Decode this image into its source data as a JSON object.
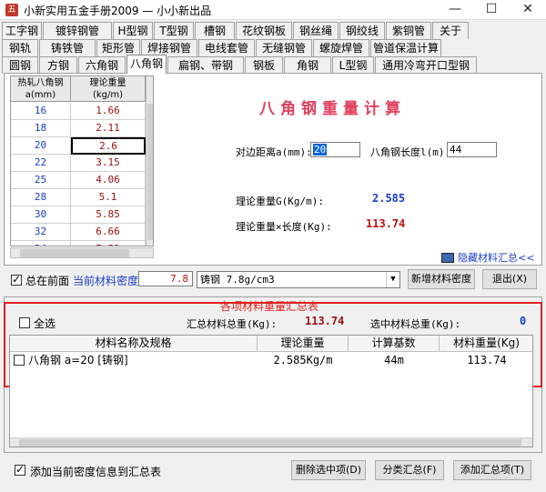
{
  "window": {
    "title": "小新实用五金手册2009 — 小小新出品",
    "app_icon": "app-logo-icon",
    "min_glyph": "—",
    "max_glyph": "☐",
    "close_glyph": "✕"
  },
  "tabs": {
    "row1": [
      "工字钢",
      "镀锌钢管",
      "H型钢",
      "T型钢",
      "槽钢",
      "花纹钢板",
      "钢丝绳",
      "钢绞线",
      "紫铜管",
      "关于"
    ],
    "row2": [
      "钢轨",
      "铸铁管",
      "矩形管",
      "焊接钢管",
      "电线套管",
      "无缝钢管",
      "螺旋焊管",
      "管道保温计算"
    ],
    "row3": [
      "圆钢",
      "方钢",
      "六角钢",
      "八角钢",
      "扁钢、带钢",
      "钢板",
      "角钢",
      "L型钢",
      "通用冷弯开口型钢"
    ],
    "active": "八角钢"
  },
  "table": {
    "header_a": "热轧八角钢\na(mm)",
    "header_w": "理论重量\n(kg/m)",
    "rows": [
      {
        "a": "16",
        "w": "1.66"
      },
      {
        "a": "18",
        "w": "2.11"
      },
      {
        "a": "20",
        "w": "2.6"
      },
      {
        "a": "22",
        "w": "3.15"
      },
      {
        "a": "25",
        "w": "4.06"
      },
      {
        "a": "28",
        "w": "5.1"
      },
      {
        "a": "30",
        "w": "5.85"
      },
      {
        "a": "32",
        "w": "6.66"
      },
      {
        "a": "34",
        "w": "7.51"
      }
    ]
  },
  "calc": {
    "title": "八角钢重量计算",
    "dist_label": "对边距离a(mm):",
    "dist_value": "20",
    "len_label": "八角钢长度l(m):",
    "len_value": "44",
    "weight_label": "理论重量G(Kg/m):",
    "weight_value": "2.585",
    "total_label": "理论重量×长度(Kg):",
    "total_value": "113.74",
    "hide_link": "隐藏材料汇总<<"
  },
  "controls": {
    "front_label": "总在前面",
    "density_label": "当前材料密度:",
    "density_value": "7.8",
    "material_value": "铸钢 7.8g/cm3",
    "new_density_btn": "新增材料密度",
    "exit_btn": "退出(X)"
  },
  "summary": {
    "title": "各项材料重量汇总表",
    "select_all": "全选",
    "total_label": "汇总材料总重(Kg):",
    "total_value": "113.74",
    "selected_label": "选中材料总重(Kg):",
    "selected_value": "0",
    "columns": [
      "材料名称及规格",
      "理论重量",
      "计算基数",
      "材料重量(Kg)"
    ],
    "rows": [
      {
        "name": "八角钢 a=20 [铸钢]",
        "weight": "2.585Kg/m",
        "base": "44m",
        "mass": "113.74"
      }
    ]
  },
  "footer": {
    "add_density_label": "添加当前密度信息到汇总表",
    "delete_btn": "删除选中项(D)",
    "classify_btn": "分类汇总(F)",
    "add_btn": "添加汇总项(T)"
  }
}
